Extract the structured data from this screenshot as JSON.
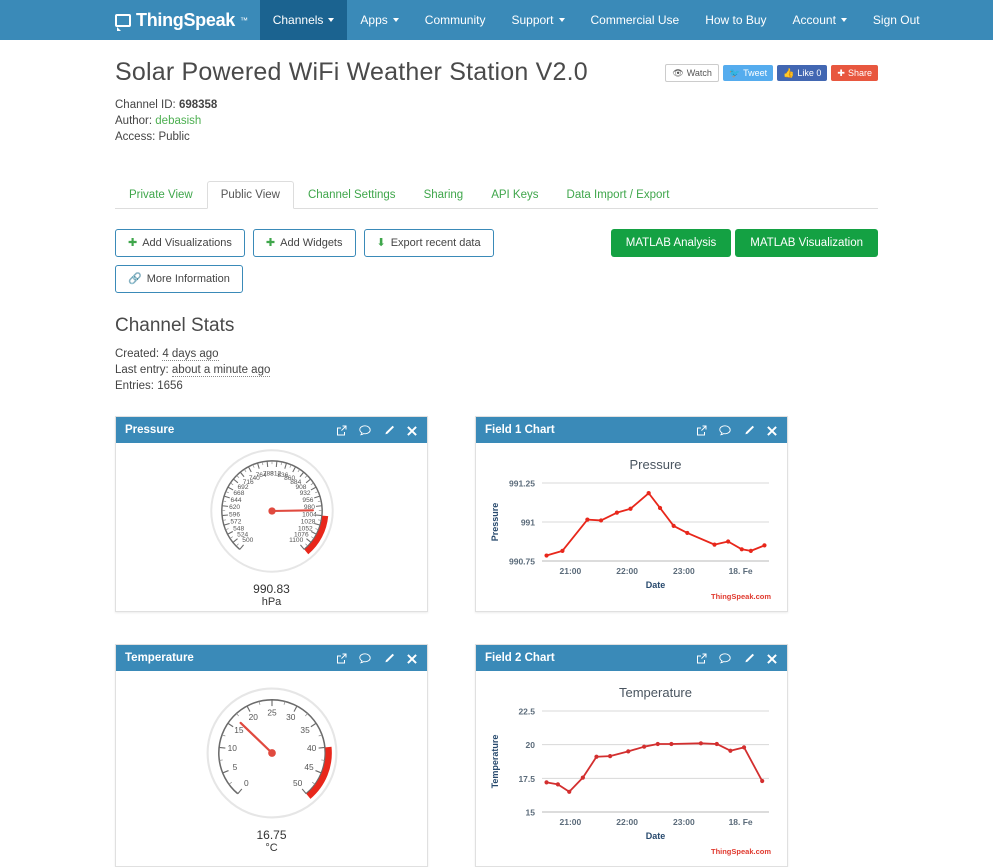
{
  "navbar": {
    "brand": "ThingSpeak",
    "brand_tm": "™",
    "left_items": [
      {
        "label": "Channels",
        "caret": true,
        "active": true
      },
      {
        "label": "Apps",
        "caret": true,
        "active": false
      },
      {
        "label": "Community",
        "caret": false,
        "active": false
      },
      {
        "label": "Support",
        "caret": true,
        "active": false
      }
    ],
    "right_items": [
      {
        "label": "Commercial Use",
        "caret": false
      },
      {
        "label": "How to Buy",
        "caret": false
      },
      {
        "label": "Account",
        "caret": true
      },
      {
        "label": "Sign Out",
        "caret": false
      }
    ],
    "bg_color": "#3a8ab8",
    "active_color": "#1b6390"
  },
  "channel": {
    "title": "Solar Powered WiFi Weather Station V2.0",
    "id_label": "Channel ID:",
    "id_value": "698358",
    "author_label": "Author:",
    "author_value": "debasish",
    "access_label": "Access:",
    "access_value": "Public"
  },
  "social": {
    "watch": "Watch",
    "tweet": "Tweet",
    "like": "Like 0",
    "share": "Share"
  },
  "tabs": [
    {
      "label": "Private View",
      "active": false
    },
    {
      "label": "Public View",
      "active": true
    },
    {
      "label": "Channel Settings",
      "active": false
    },
    {
      "label": "Sharing",
      "active": false
    },
    {
      "label": "API Keys",
      "active": false
    },
    {
      "label": "Data Import / Export",
      "active": false
    }
  ],
  "toolbar": {
    "add_visualizations": "Add Visualizations",
    "add_widgets": "Add Widgets",
    "export_recent": "Export recent data",
    "more_information": "More Information",
    "matlab_analysis": "MATLAB Analysis",
    "matlab_visualization": "MATLAB Visualization"
  },
  "stats": {
    "heading": "Channel Stats",
    "created_label": "Created:",
    "created_value": "4 days ago",
    "last_entry_label": "Last entry:",
    "last_entry_value": "about a minute ago",
    "entries_label": "Entries:",
    "entries_value": "1656"
  },
  "widgets": {
    "pressure_gauge_title": "Pressure",
    "field1_title": "Field 1 Chart",
    "temperature_gauge_title": "Temperature",
    "field2_title": "Field 2 Chart"
  },
  "chart_data": [
    {
      "type": "gauge",
      "title": "Pressure",
      "value": 990.83,
      "value_label": "990.83",
      "unit": "hPa",
      "min": 500,
      "max": 1100,
      "tick_step": 24,
      "tick_labels": [
        500,
        524,
        548,
        572,
        596,
        620,
        644,
        668,
        692,
        716,
        740,
        764,
        788,
        812,
        836,
        860,
        884,
        908,
        932,
        956,
        980,
        1004,
        1028,
        1052,
        1076,
        1100
      ],
      "band": {
        "from": 1004,
        "to": 1100,
        "color": "#e8271b"
      },
      "needle_color": "#e04a3f"
    },
    {
      "type": "line",
      "title": "Pressure",
      "xlabel": "Date",
      "ylabel": "Pressure",
      "ylim": [
        990.75,
        991.25
      ],
      "yticks": [
        990.75,
        991,
        991.25
      ],
      "ytick_labels": [
        "990.75",
        "991",
        "991.25"
      ],
      "xticks": [
        "21:00",
        "22:00",
        "23:00",
        "18. Fe"
      ],
      "credit": "ThingSpeak.com",
      "line_color": "#e8271b",
      "grid": true,
      "x": [
        0.02,
        0.09,
        0.2,
        0.26,
        0.33,
        0.39,
        0.47,
        0.52,
        0.58,
        0.64,
        0.76,
        0.82,
        0.88,
        0.92,
        0.98
      ],
      "values": [
        990.785,
        990.815,
        991.015,
        991.01,
        991.06,
        991.085,
        991.185,
        991.09,
        990.975,
        990.93,
        990.855,
        990.875,
        990.825,
        990.815,
        990.85
      ]
    },
    {
      "type": "gauge",
      "title": "Temperature",
      "value": 16.75,
      "value_label": "16.75",
      "unit": "°C",
      "min": 0,
      "max": 50,
      "tick_step": 5,
      "tick_labels": [
        0,
        5,
        10,
        15,
        20,
        25,
        30,
        35,
        40,
        45,
        50
      ],
      "band": {
        "from": 40,
        "to": 50,
        "color": "#e8271b"
      },
      "needle_color": "#e04a3f"
    },
    {
      "type": "line",
      "title": "Temperature",
      "xlabel": "Date",
      "ylabel": "Temperature",
      "ylim": [
        15,
        22.5
      ],
      "yticks": [
        15,
        17.5,
        20,
        22.5
      ],
      "ytick_labels": [
        "15",
        "17.5",
        "20",
        "22.5"
      ],
      "xticks": [
        "21:00",
        "22:00",
        "23:00",
        "18. Fe"
      ],
      "credit": "ThingSpeak.com",
      "line_color": "#d32f2f",
      "grid": true,
      "x": [
        0.02,
        0.07,
        0.12,
        0.18,
        0.24,
        0.3,
        0.38,
        0.45,
        0.51,
        0.57,
        0.7,
        0.77,
        0.83,
        0.89,
        0.97
      ],
      "values": [
        17.2,
        17.05,
        16.5,
        17.55,
        19.1,
        19.15,
        19.5,
        19.85,
        20.05,
        20.05,
        20.1,
        20.05,
        19.55,
        19.8,
        17.3
      ]
    }
  ]
}
